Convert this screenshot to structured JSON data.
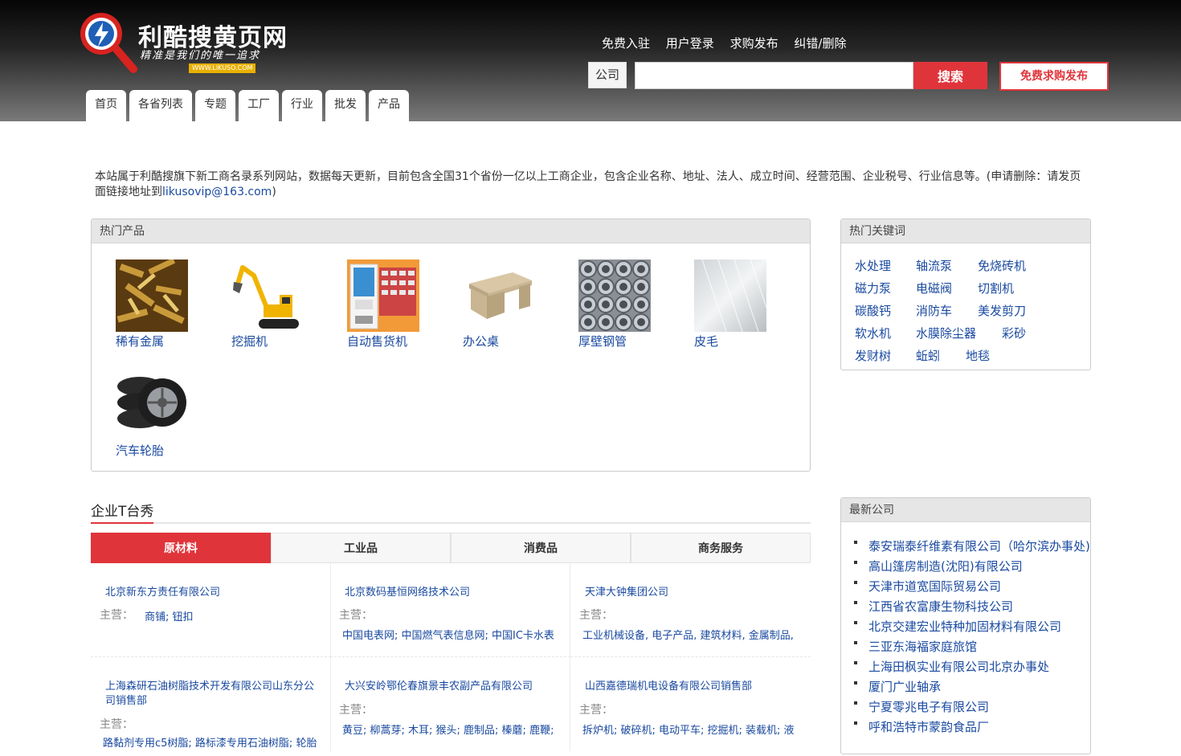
{
  "site": {
    "title": "利酷搜黄页网",
    "slogan": "精准是我们的唯一追求",
    "url_badge": "WWW.LIKUSO.COM"
  },
  "top_links": [
    "免费入驻",
    "用户登录",
    "求购发布",
    "纠错/删除"
  ],
  "search": {
    "scope": "公司",
    "value": "",
    "button": "搜索",
    "post_button": "免费求购发布"
  },
  "nav": [
    "首页",
    "各省列表",
    "专题",
    "工厂",
    "行业",
    "批发",
    "产品"
  ],
  "notice": {
    "text": "本站属于利酷搜旗下新工商名录系列网站，数据每天更新，目前包含全国31个省份一亿以上工商企业，包含企业名称、地址、法人、成立时间、经营范围、企业税号、行业信息等。(申请删除：请发页面链接地址到",
    "email": "likusovip@163.com",
    "tail": ")"
  },
  "hot_products": {
    "title": "热门产品",
    "items": [
      {
        "name": "稀有金属",
        "icon": "rare-metal-image"
      },
      {
        "name": "挖掘机",
        "icon": "excavator-image"
      },
      {
        "name": "自动售货机",
        "icon": "vending-machine-image"
      },
      {
        "name": "办公桌",
        "icon": "office-desk-image"
      },
      {
        "name": "厚壁钢管",
        "icon": "steel-pipe-image"
      },
      {
        "name": "皮毛",
        "icon": "fur-image"
      },
      {
        "name": "汽车轮胎",
        "icon": "car-tire-image"
      }
    ]
  },
  "hot_keywords": {
    "title": "热门关键词",
    "items": [
      "水处理",
      "轴流泵",
      "免烧砖机",
      "磁力泵",
      "电磁阀",
      "切割机",
      "碳酸钙",
      "消防车",
      "美发剪刀",
      "软水机",
      "水膜除尘器",
      "彩砂",
      "发财树",
      "蚯蚓",
      "地毯"
    ]
  },
  "showcase": {
    "title": "企业T台秀",
    "tabs": [
      "原材料",
      "工业品",
      "消费品",
      "商务服务"
    ],
    "active_tab": 0,
    "main_label": "主营：",
    "companies": [
      {
        "name": "北京新东方责任有限公司",
        "main": "商铺; 钮扣"
      },
      {
        "name": "北京数码基恒网络技术公司",
        "main": "中国电表网; 中国燃气表信息网; 中国IC卡水表"
      },
      {
        "name": "天津大钟集团公司",
        "main": "工业机械设备, 电子产品, 建筑材料, 金属制品,"
      },
      {
        "name": "上海森研石油树脂技术开发有限公司山东分公司销售部",
        "main": "路黏剂专用c5树脂; 路标漆专用石油树脂; 轮胎"
      },
      {
        "name": "大兴安岭鄂伦春旗景丰农副产品有限公司",
        "main": "黄豆; 柳蒿芽; 木耳; 猴头; 鹿制品; 榛蘑; 鹿鞭;"
      },
      {
        "name": "山西嘉德瑞机电设备有限公司销售部",
        "main": "拆炉机; 破碎机; 电动平车; 挖掘机; 装载机; 液"
      }
    ]
  },
  "latest_companies": {
    "title": "最新公司",
    "items": [
      "泰安瑞泰纤维素有限公司（哈尔滨办事处)",
      "高山篷房制造(沈阳)有限公司",
      "天津市道宽国际贸易公司",
      "江西省农富康生物科技公司",
      "北京交建宏业特种加固材料有限公司",
      "三亚东海福家庭旅馆",
      "上海田枫实业有限公司北京办事处",
      "厦门广业轴承",
      "宁夏零兆电子有限公司",
      "呼和浩特市蒙韵食品厂"
    ]
  },
  "colors": {
    "accent": "#e0343b",
    "link": "#1a4aa0",
    "badge": "#e8b000"
  }
}
